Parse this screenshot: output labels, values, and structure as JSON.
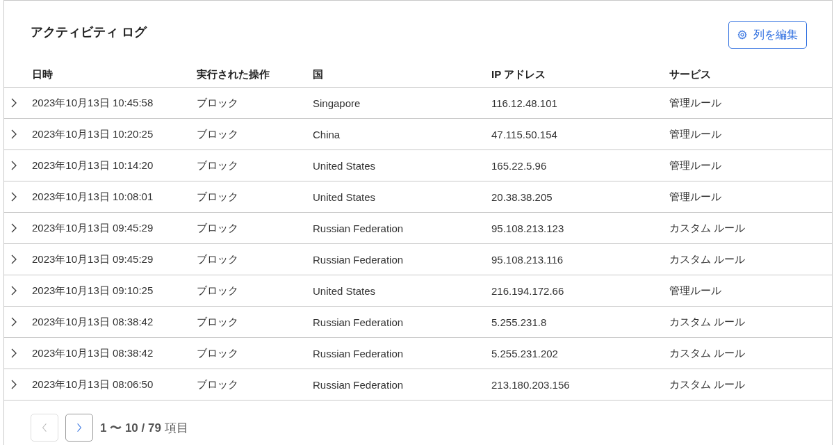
{
  "title": "アクティビティ ログ",
  "edit_columns_button": "列を編集",
  "table": {
    "columns": [
      "日時",
      "実行された操作",
      "国",
      "IP アドレス",
      "サービス"
    ],
    "rows": [
      {
        "expanded": false,
        "cells": [
          "2023年10月13日 10:45:58",
          "ブロック",
          "Singapore",
          "116.12.48.101",
          "管理ルール"
        ]
      },
      {
        "expanded": false,
        "cells": [
          "2023年10月13日 10:20:25",
          "ブロック",
          "China",
          "47.115.50.154",
          "管理ルール"
        ]
      },
      {
        "expanded": false,
        "cells": [
          "2023年10月13日 10:14:20",
          "ブロック",
          "United States",
          "165.22.5.96",
          "管理ルール"
        ]
      },
      {
        "expanded": false,
        "cells": [
          "2023年10月13日 10:08:01",
          "ブロック",
          "United States",
          "20.38.38.205",
          "管理ルール"
        ]
      },
      {
        "expanded": false,
        "cells": [
          "2023年10月13日 09:45:29",
          "ブロック",
          "Russian Federation",
          "95.108.213.123",
          "カスタム ルール"
        ]
      },
      {
        "expanded": false,
        "cells": [
          "2023年10月13日 09:45:29",
          "ブロック",
          "Russian Federation",
          "95.108.213.116",
          "カスタム ルール"
        ]
      },
      {
        "expanded": false,
        "cells": [
          "2023年10月13日 09:10:25",
          "ブロック",
          "United States",
          "216.194.172.66",
          "管理ルール"
        ]
      },
      {
        "expanded": false,
        "cells": [
          "2023年10月13日 08:38:42",
          "ブロック",
          "Russian Federation",
          "5.255.231.8",
          "カスタム ルール"
        ]
      },
      {
        "expanded": false,
        "cells": [
          "2023年10月13日 08:38:42",
          "ブロック",
          "Russian Federation",
          "5.255.231.202",
          "カスタム ルール"
        ]
      },
      {
        "expanded": false,
        "cells": [
          "2023年10月13日 08:06:50",
          "ブロック",
          "Russian Federation",
          "213.180.203.156",
          "カスタム ルール"
        ]
      }
    ]
  },
  "pagination": {
    "previous_disabled": true,
    "next_disabled": false,
    "summary": "**1 〜 10 / 79** 項目"
  }
}
